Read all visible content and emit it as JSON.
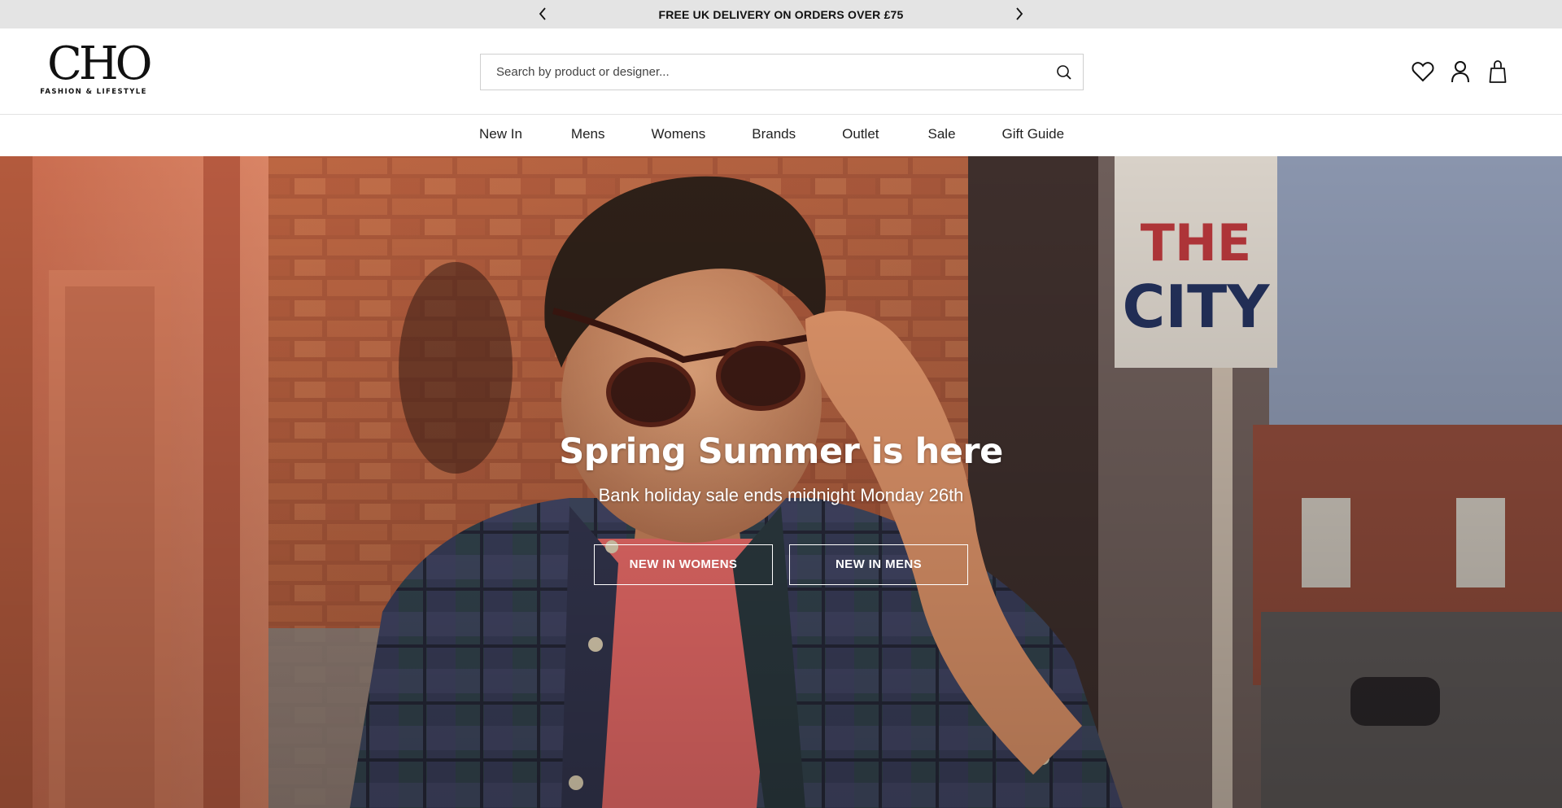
{
  "announcement": {
    "message": "FREE UK DELIVERY ON ORDERS OVER £75",
    "prev_icon": "chevron-left-icon",
    "next_icon": "chevron-right-icon"
  },
  "header": {
    "logo": {
      "mark": "CHO",
      "tagline": "FASHION & LIFESTYLE"
    },
    "search": {
      "placeholder": "Search by product or designer...",
      "value": "",
      "icon": "search-icon"
    },
    "icons": [
      "heart-icon",
      "user-icon",
      "bag-icon"
    ]
  },
  "nav": {
    "items": [
      {
        "label": "New In"
      },
      {
        "label": "Mens"
      },
      {
        "label": "Womens"
      },
      {
        "label": "Brands"
      },
      {
        "label": "Outlet"
      },
      {
        "label": "Sale"
      },
      {
        "label": "Gift Guide"
      }
    ]
  },
  "hero": {
    "title": "Spring Summer is here",
    "subtitle": "Bank holiday sale ends midnight Monday 26th",
    "buttons": {
      "womens": "NEW IN WOMENS",
      "mens": "NEW IN MENS"
    },
    "background_sign_text": "THE CITY"
  },
  "colors": {
    "announcement_bg": "#e4e4e4",
    "text": "#111111",
    "hero_overlay_text": "#ffffff"
  }
}
